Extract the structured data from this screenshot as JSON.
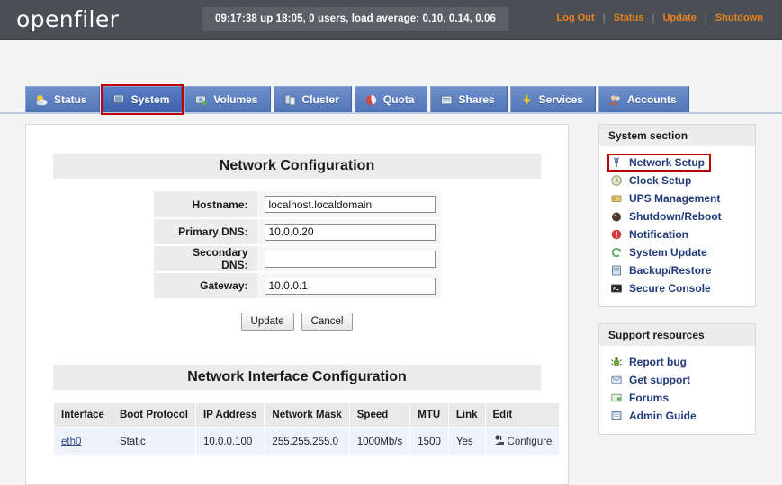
{
  "header": {
    "logo": "openfiler",
    "status": "09:17:38 up 18:05, 0 users, load average: 0.10, 0.14, 0.06",
    "links": [
      {
        "label": "Log Out",
        "name": "log-out-link"
      },
      {
        "label": "Status",
        "name": "status-link"
      },
      {
        "label": "Update",
        "name": "update-link"
      },
      {
        "label": "Shutdown",
        "name": "shutdown-link"
      }
    ],
    "separator": "|",
    "bar_color": "#4b4f55",
    "link_color": "#e8821e"
  },
  "tabs": [
    {
      "label": "Status",
      "icon": "weather-icon",
      "active": false
    },
    {
      "label": "System",
      "icon": "monitor-icon",
      "active": true
    },
    {
      "label": "Volumes",
      "icon": "disk-icon",
      "active": false
    },
    {
      "label": "Cluster",
      "icon": "cluster-icon",
      "active": false
    },
    {
      "label": "Quota",
      "icon": "pie-icon",
      "active": false
    },
    {
      "label": "Shares",
      "icon": "folder-share-icon",
      "active": false
    },
    {
      "label": "Services",
      "icon": "bolt-icon",
      "active": false
    },
    {
      "label": "Accounts",
      "icon": "people-icon",
      "active": false
    }
  ],
  "highlight_color": "#c00000",
  "main": {
    "network_config": {
      "title": "Network Configuration",
      "fields": [
        {
          "label": "Hostname:",
          "value": "localhost.localdomain",
          "name": "hostname-field"
        },
        {
          "label": "Primary DNS:",
          "value": "10.0.0.20",
          "name": "primary-dns-field"
        },
        {
          "label": "Secondary DNS:",
          "value": "",
          "name": "secondary-dns-field"
        },
        {
          "label": "Gateway:",
          "value": "10.0.0.1",
          "name": "gateway-field"
        }
      ],
      "update_label": "Update",
      "cancel_label": "Cancel"
    },
    "interface_config": {
      "title": "Network Interface Configuration",
      "columns": [
        "Interface",
        "Boot Protocol",
        "IP Address",
        "Network Mask",
        "Speed",
        "MTU",
        "Link",
        "Edit"
      ],
      "rows": [
        {
          "interface": "eth0",
          "boot_protocol": "Static",
          "ip_address": "10.0.0.100",
          "network_mask": "255.255.255.0",
          "speed": "1000Mb/s",
          "mtu": "1500",
          "link": "Yes",
          "edit": "Configure"
        }
      ]
    }
  },
  "sidebar": {
    "system_section": {
      "title": "System section",
      "items": [
        {
          "label": "Network Setup",
          "icon": "plug-icon",
          "highlighted": true
        },
        {
          "label": "Clock Setup",
          "icon": "clock-icon",
          "highlighted": false
        },
        {
          "label": "UPS Management",
          "icon": "battery-icon",
          "highlighted": false
        },
        {
          "label": "Shutdown/Reboot",
          "icon": "power-icon",
          "highlighted": false
        },
        {
          "label": "Notification",
          "icon": "alert-icon",
          "highlighted": false
        },
        {
          "label": "System Update",
          "icon": "refresh-icon",
          "highlighted": false
        },
        {
          "label": "Backup/Restore",
          "icon": "archive-icon",
          "highlighted": false
        },
        {
          "label": "Secure Console",
          "icon": "terminal-icon",
          "highlighted": false
        }
      ]
    },
    "support_resources": {
      "title": "Support resources",
      "items": [
        {
          "label": "Report bug",
          "icon": "bug-icon"
        },
        {
          "label": "Get support",
          "icon": "support-icon"
        },
        {
          "label": "Forums",
          "icon": "forum-icon",
          "highlighted": false
        },
        {
          "label": "Admin Guide",
          "icon": "book-icon"
        }
      ]
    }
  }
}
